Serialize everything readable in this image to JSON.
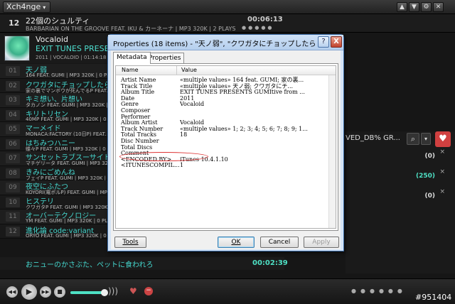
{
  "app": {
    "menu_label": "Xch4nge",
    "caret": "▾"
  },
  "window_buttons": [
    "▲",
    "▼",
    "⚙",
    "✕"
  ],
  "now_playing": {
    "index": "12",
    "title": "22個のシュルティ",
    "subtitle": "BARBARIAN ON THE GROOVE FEAT. IKU & カーネーナ | MP3 320K | 2 PLAYS",
    "time": "00:06:13",
    "dots": "●●●●●"
  },
  "album": {
    "artist": "Vocaloid",
    "title": "EXIT TUNES PRESENTS",
    "meta": "2011 | VOCALOID | 01:14:18"
  },
  "tracks": [
    {
      "num": "01",
      "title": "天ノ弱",
      "sub": "164 FEAT. GUMI | MP3 320K | 0 PL"
    },
    {
      "num": "02",
      "title": "クワガタにチョップしたらタ",
      "sub": "家の裏でマンボウが死んでるP FEAT. GU"
    },
    {
      "num": "03",
      "title": "キミ想い、片想い",
      "sub": "タカノン FEAT. GUMI | MP3 320K | 0"
    },
    {
      "num": "04",
      "title": "キリトリセン",
      "sub": "40MP FEAT. GUMI | MP3 320K | 0 PL"
    },
    {
      "num": "05",
      "title": "マーメイド",
      "sub": "MONACA:FACTORY (10日P) FEAT. GUMI"
    },
    {
      "num": "06",
      "title": "はちみつハニー",
      "sub": "蝶々P FEAT. GUMI | MP3 320K | 0 P"
    },
    {
      "num": "07",
      "title": "サンセットラブスーサイド",
      "sub": "マチゲリータ FEAT. GUMI | MP3 320K"
    },
    {
      "num": "08",
      "title": "きみにごめんね",
      "sub": "フェイP FEAT. GUMI | MP3 320K | 0"
    },
    {
      "num": "09",
      "title": "夜空にふたつ",
      "sub": "KOYORI(電ポルP) FEAT. GUMI | MP3 3"
    },
    {
      "num": "10",
      "title": "ヒステリ",
      "sub": "クワガタP FEAT. GUMI | MP3 320K |"
    },
    {
      "num": "11",
      "title": "オーバーテクノロジー",
      "sub": "YM FEAT. GUMI | MP3 320K | 0 PLAY"
    },
    {
      "num": "12",
      "title": "進化論 code:variant",
      "sub": "ORYO FEAT. GUMI | MP3 320K | 0 PLA"
    }
  ],
  "last_row": {
    "title": "おニューのかさぶた、ペットに食われろ",
    "time": "00:02:39"
  },
  "right_panel": {
    "search_label": "VED_DB% GR...",
    "search_icon": "⌕",
    "dropdown_icon": "▾",
    "heart_icon": "♥",
    "rows": [
      {
        "count": "(0)",
        "color": "#dddddd"
      },
      {
        "count": "(250)",
        "color": "#4ee0c4"
      },
      {
        "count": "(0)",
        "color": "#dddddd"
      }
    ],
    "close_glyph": "×"
  },
  "transport": {
    "prev": "◀◀",
    "play": "▶",
    "next": "▶▶",
    "stop": "■",
    "volume": 0.92,
    "volume_icon": ")))",
    "heart": "♥",
    "ban": "−",
    "dots": "●●●●●●"
  },
  "watermark": "#951404",
  "dialog": {
    "title": "Properties (18 items) - \"天ノ弱\", \"クワガタにチョップしたらタ...",
    "help": "?",
    "close": "X",
    "tabs": [
      "Metadata",
      "Properties"
    ],
    "columns": [
      "Name",
      "Value"
    ],
    "rows": [
      {
        "name": "Artist Name",
        "value": "«multiple values» 164 feat. GUMI; 家の裏..."
      },
      {
        "name": "Track Title",
        "value": "«multiple values» 天ノ弱; クワガタにチ..."
      },
      {
        "name": "Album Title",
        "value": "EXIT TUNES PRESENTS GUMItive from ..."
      },
      {
        "name": "Date",
        "value": "2011"
      },
      {
        "name": "Genre",
        "value": "Vocaloid"
      },
      {
        "name": "Composer",
        "value": ""
      },
      {
        "name": "Performer",
        "value": ""
      },
      {
        "name": "Album Artist",
        "value": "Vocaloid"
      },
      {
        "name": "Track Number",
        "value": "«multiple values» 1; 2; 3; 4; 5; 6; 7; 8; 9; 1..."
      },
      {
        "name": "Total Tracks",
        "value": "18"
      },
      {
        "name": "Disc Number",
        "value": ""
      },
      {
        "name": "Total Discs",
        "value": ""
      },
      {
        "name": "Comment",
        "value": ""
      },
      {
        "name": "<ENCODED BY>",
        "value": "iTunes 10.4.1.10"
      },
      {
        "name": "<ITUNESCOMPIL...",
        "value": "1"
      }
    ],
    "buttons": {
      "tools": "Tools",
      "ok": "OK",
      "cancel": "Cancel",
      "apply": "Apply"
    }
  }
}
